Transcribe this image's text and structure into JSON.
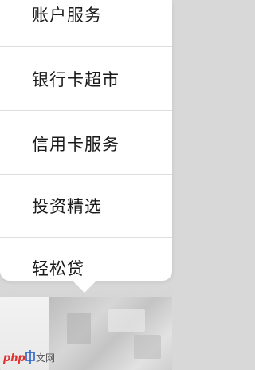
{
  "menu": {
    "items": [
      {
        "label": "账户服务"
      },
      {
        "label": "银行卡超市"
      },
      {
        "label": "信用卡服务"
      },
      {
        "label": "投资精选"
      },
      {
        "label": "轻松贷"
      }
    ]
  },
  "watermark": {
    "text": "php中文网"
  },
  "colors": {
    "menu_background": "#ffffff",
    "divider": "#dedede",
    "text": "#1a1a1a",
    "watermark_red": "#e0312e",
    "watermark_blue": "#2b62c9"
  }
}
